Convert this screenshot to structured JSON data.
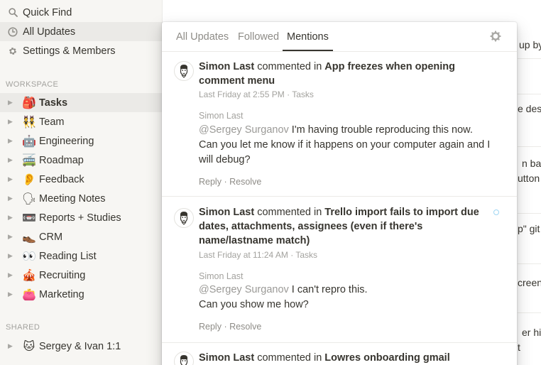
{
  "sidebar": {
    "quick_find": "Quick Find",
    "all_updates": "All Updates",
    "settings": "Settings & Members",
    "workspace_header": "WORKSPACE",
    "pages": [
      {
        "emoji": "🎒",
        "label": "Tasks"
      },
      {
        "emoji": "👯",
        "label": "Team"
      },
      {
        "emoji": "🤖",
        "label": "Engineering"
      },
      {
        "emoji": "🚎",
        "label": "Roadmap"
      },
      {
        "emoji": "👂",
        "label": "Feedback"
      },
      {
        "emoji": "🗣",
        "label": "Meeting Notes"
      },
      {
        "emoji": "📼",
        "label": "Reports + Studies"
      },
      {
        "emoji": "👞",
        "label": "CRM"
      },
      {
        "emoji": "👀",
        "label": "Reading List"
      },
      {
        "emoji": "🎪",
        "label": "Recruiting"
      },
      {
        "emoji": "👛",
        "label": "Marketing"
      }
    ],
    "shared_header": "SHARED",
    "shared_pages": [
      {
        "emoji": "🐱",
        "label": "Sergey & Ivan 1:1"
      }
    ]
  },
  "background_fragments": [
    "up by",
    "e desi",
    "n bar",
    "utton",
    "p\" git",
    "creen",
    "er hi",
    "t"
  ],
  "popup": {
    "tabs": [
      "All Updates",
      "Followed",
      "Mentions"
    ],
    "active_tab": "Mentions",
    "items": [
      {
        "user": "Simon Last",
        "verb": "commented in",
        "page_line1": "App freezes when opening",
        "page_line2": "comment menu",
        "page_line3": "",
        "time": "Last Friday at 2:55 PM",
        "location": "Tasks",
        "author": "Simon Last",
        "body_mention": "@Sergey Surganov",
        "body_line1": " I'm having trouble reproducing this now.",
        "body_line2": "Can you let me know if it happens on your computer again and I",
        "body_line3": "will debug?",
        "reply": "Reply",
        "resolve": "Resolve"
      },
      {
        "user": "Simon Last",
        "verb": "commented in",
        "page_line1": "Trello import fails to import due",
        "page_line2": "dates, attachments, assignees (even if there's",
        "page_line3": "name/lastname match)",
        "time": "Last Friday at 11:24 AM",
        "location": "Tasks",
        "author": "Simon Last",
        "body_mention": "@Sergey Surganov",
        "body_line1": " I can't repro this.",
        "body_line2": "Can you show me how?",
        "body_line3": "",
        "reply": "Reply",
        "resolve": "Resolve"
      },
      {
        "user": "Simon Last",
        "verb": "commented in",
        "page_line1": "Lowres onboarding gmail avatar",
        "page_line2": "",
        "page_line3": "",
        "time": "",
        "location": "",
        "author": "",
        "body_mention": "",
        "body_line1": "",
        "body_line2": "",
        "body_line3": "",
        "reply": "",
        "resolve": ""
      }
    ],
    "separator": "·"
  }
}
